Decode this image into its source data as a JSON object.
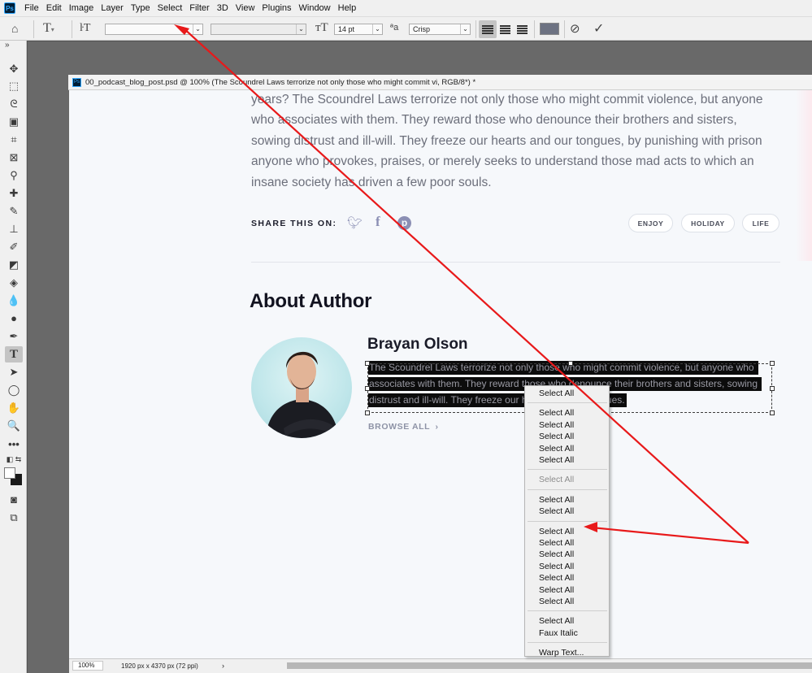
{
  "menubar": {
    "logo": "Ps",
    "items": [
      "File",
      "Edit",
      "Image",
      "Layer",
      "Type",
      "Select",
      "Filter",
      "3D",
      "View",
      "Plugins",
      "Window",
      "Help"
    ]
  },
  "options_bar": {
    "font_family_value": "",
    "font_style_value": "",
    "font_size": "14 pt",
    "antialias_icon_label": "ªa",
    "antialias": "Crisp",
    "swatch_color": "#6d7282"
  },
  "document": {
    "tab_title": "00_podcast_blog_post.psd @ 100% (The Scoundrel Laws terrorize not only those who might commit vi, RGB/8*) *",
    "zoom": "100%",
    "dimensions": "1920 px x 4370 px (72 ppi)"
  },
  "page": {
    "body_paragraph": "years? The Scoundrel Laws terrorize not only those who might commit violence, but anyone who associates with them. They reward those who denounce their brothers and sisters, sowing distrust and ill-will. They freeze our hearts and our tongues, by punishing with prison anyone who provokes, praises, or merely seeks to understand those mad acts to which an insane society has driven a few poor souls.",
    "share_label": "SHARE THIS ON:",
    "social_icons": [
      "twitter-icon",
      "facebook-icon",
      "pinterest-icon"
    ],
    "tags": [
      "ENJOY",
      "HOLIDAY",
      "LIFE"
    ],
    "about_title": "About Author",
    "author_name": "Brayan Olson",
    "selected_lines": [
      "The Scoundrel Laws terrorize not only those who might commit violence, but anyone who",
      "associates with them. They reward those who denounce their brothers and sisters, sowing",
      "distrust and ill-will. They freeze our hearts and our tongues."
    ],
    "browse_label": "BROWSE ALL"
  },
  "context_menu": {
    "groups": [
      [
        {
          "label": "Select All",
          "enabled": true
        }
      ],
      [
        {
          "label": "Select All",
          "enabled": true
        },
        {
          "label": "Select All",
          "enabled": true
        },
        {
          "label": "Select All",
          "enabled": true
        },
        {
          "label": "Select All",
          "enabled": true
        },
        {
          "label": "Select All",
          "enabled": true
        }
      ],
      [
        {
          "label": "Select All",
          "enabled": false
        }
      ],
      [
        {
          "label": "Select All",
          "enabled": true
        },
        {
          "label": "Select All",
          "enabled": true
        }
      ],
      [
        {
          "label": "Select All",
          "enabled": true
        },
        {
          "label": "Select All",
          "enabled": true
        },
        {
          "label": "Select All",
          "enabled": true
        },
        {
          "label": "Select All",
          "enabled": true
        },
        {
          "label": "Select All",
          "enabled": true
        },
        {
          "label": "Select All",
          "enabled": true
        },
        {
          "label": "Select All",
          "enabled": true
        }
      ],
      [
        {
          "label": "Select All",
          "enabled": true
        },
        {
          "label": "Faux Italic",
          "enabled": true
        }
      ],
      [
        {
          "label": "Warp Text...",
          "enabled": true
        }
      ]
    ]
  },
  "colors": {
    "annotation": "#e8191a",
    "selection_bg": "#0c0c0c",
    "text_muted": "#6c6f7b",
    "heading": "#121320"
  }
}
